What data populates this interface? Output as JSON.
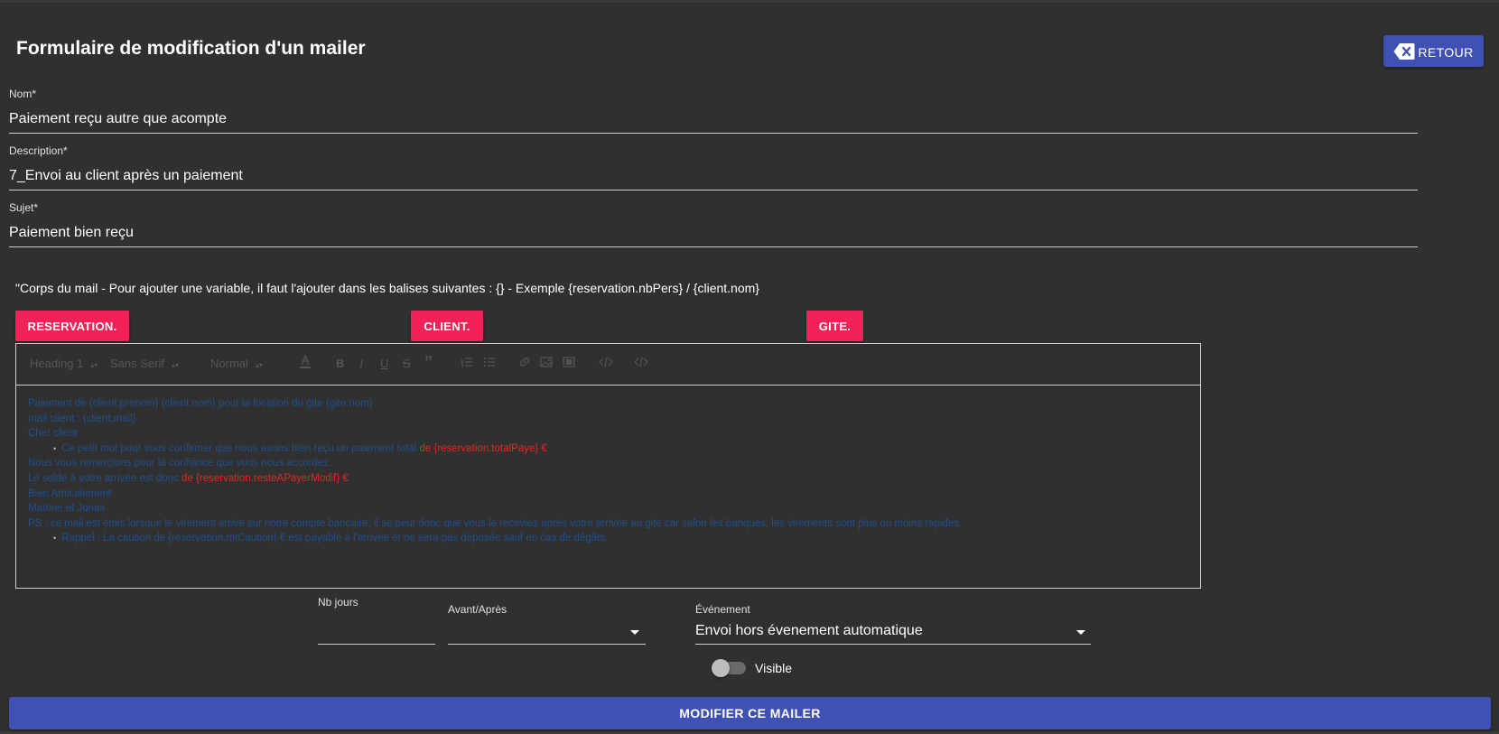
{
  "page": {
    "title": "Formulaire de modification d'un mailer",
    "back_button": "RETOUR"
  },
  "fields": {
    "nom": {
      "label": "Nom*",
      "value": "Paiement reçu autre que acompte"
    },
    "description": {
      "label": "Description*",
      "value": "7_Envoi au client après un paiement"
    },
    "sujet": {
      "label": "Sujet*",
      "value": "Paiement bien reçu"
    }
  },
  "help_text": "\"Corps du mail - Pour ajouter une variable, il faut l'ajouter dans les balises suivantes : {} - Exemple {reservation.nbPers} / {client.nom}",
  "variable_buttons": {
    "reservation": "RESERVATION.",
    "client": "CLIENT.",
    "gite": "GITE."
  },
  "editor": {
    "toolbar": {
      "heading": "Heading 1",
      "font": "Sans Serif",
      "size": "Normal",
      "color_icon": "text-color-icon",
      "bold": "B",
      "italic": "I",
      "underline": "U",
      "strike": "S",
      "quote": "”",
      "ordered_icon": "ordered-list-icon",
      "bullet_icon": "bullet-list-icon",
      "link_icon": "link-icon",
      "image_icon": "image-icon",
      "video_icon": "video-icon",
      "code_icon": "code-icon",
      "code_block_icon": "code-block-icon"
    },
    "content": {
      "l1": "Paiement de {client.prenom} {client.nom} pour la location du gite {gite.nom}",
      "l2": "mail client : {client.mail}",
      "l3": "Cher client",
      "l4a": "Ce petit mot pour vous confirmer que nous avons bien reçu un paiement total ",
      "l4b": "de {reservation.totalPaye} €",
      "l5": "Nous vous remerçions pour la confiance que vous nous accordez.",
      "l6a": "Le solde à votre arrivée est donc ",
      "l6b": "de {reservation.resteAPayerModif} €",
      "l7": "Bien Amicalement",
      "l8": "Martine et Jonas",
      "l9": "PS : ce mail est émis lorsque le virement arrive sur notre compte bancaire, il se peut donc que vous le receviez après votre arrivée au gite car selon les banques, les virements sont plus ou moins rapides.",
      "l10": "Rappel : La caution de {reservation.mtCaution} € est payable à l'arrivée et ne sera pas déposée sauf en cas de dégâts."
    }
  },
  "schedule": {
    "nb_jours": {
      "label": "Nb jours",
      "value": ""
    },
    "avant_apres": {
      "label": "Avant/Après",
      "value": ""
    },
    "evenement": {
      "label": "Événement",
      "value": "Envoi hors évenement automatique"
    }
  },
  "visible": {
    "label": "Visible",
    "checked": false
  },
  "submit_button": "MODIFIER CE MAILER"
}
